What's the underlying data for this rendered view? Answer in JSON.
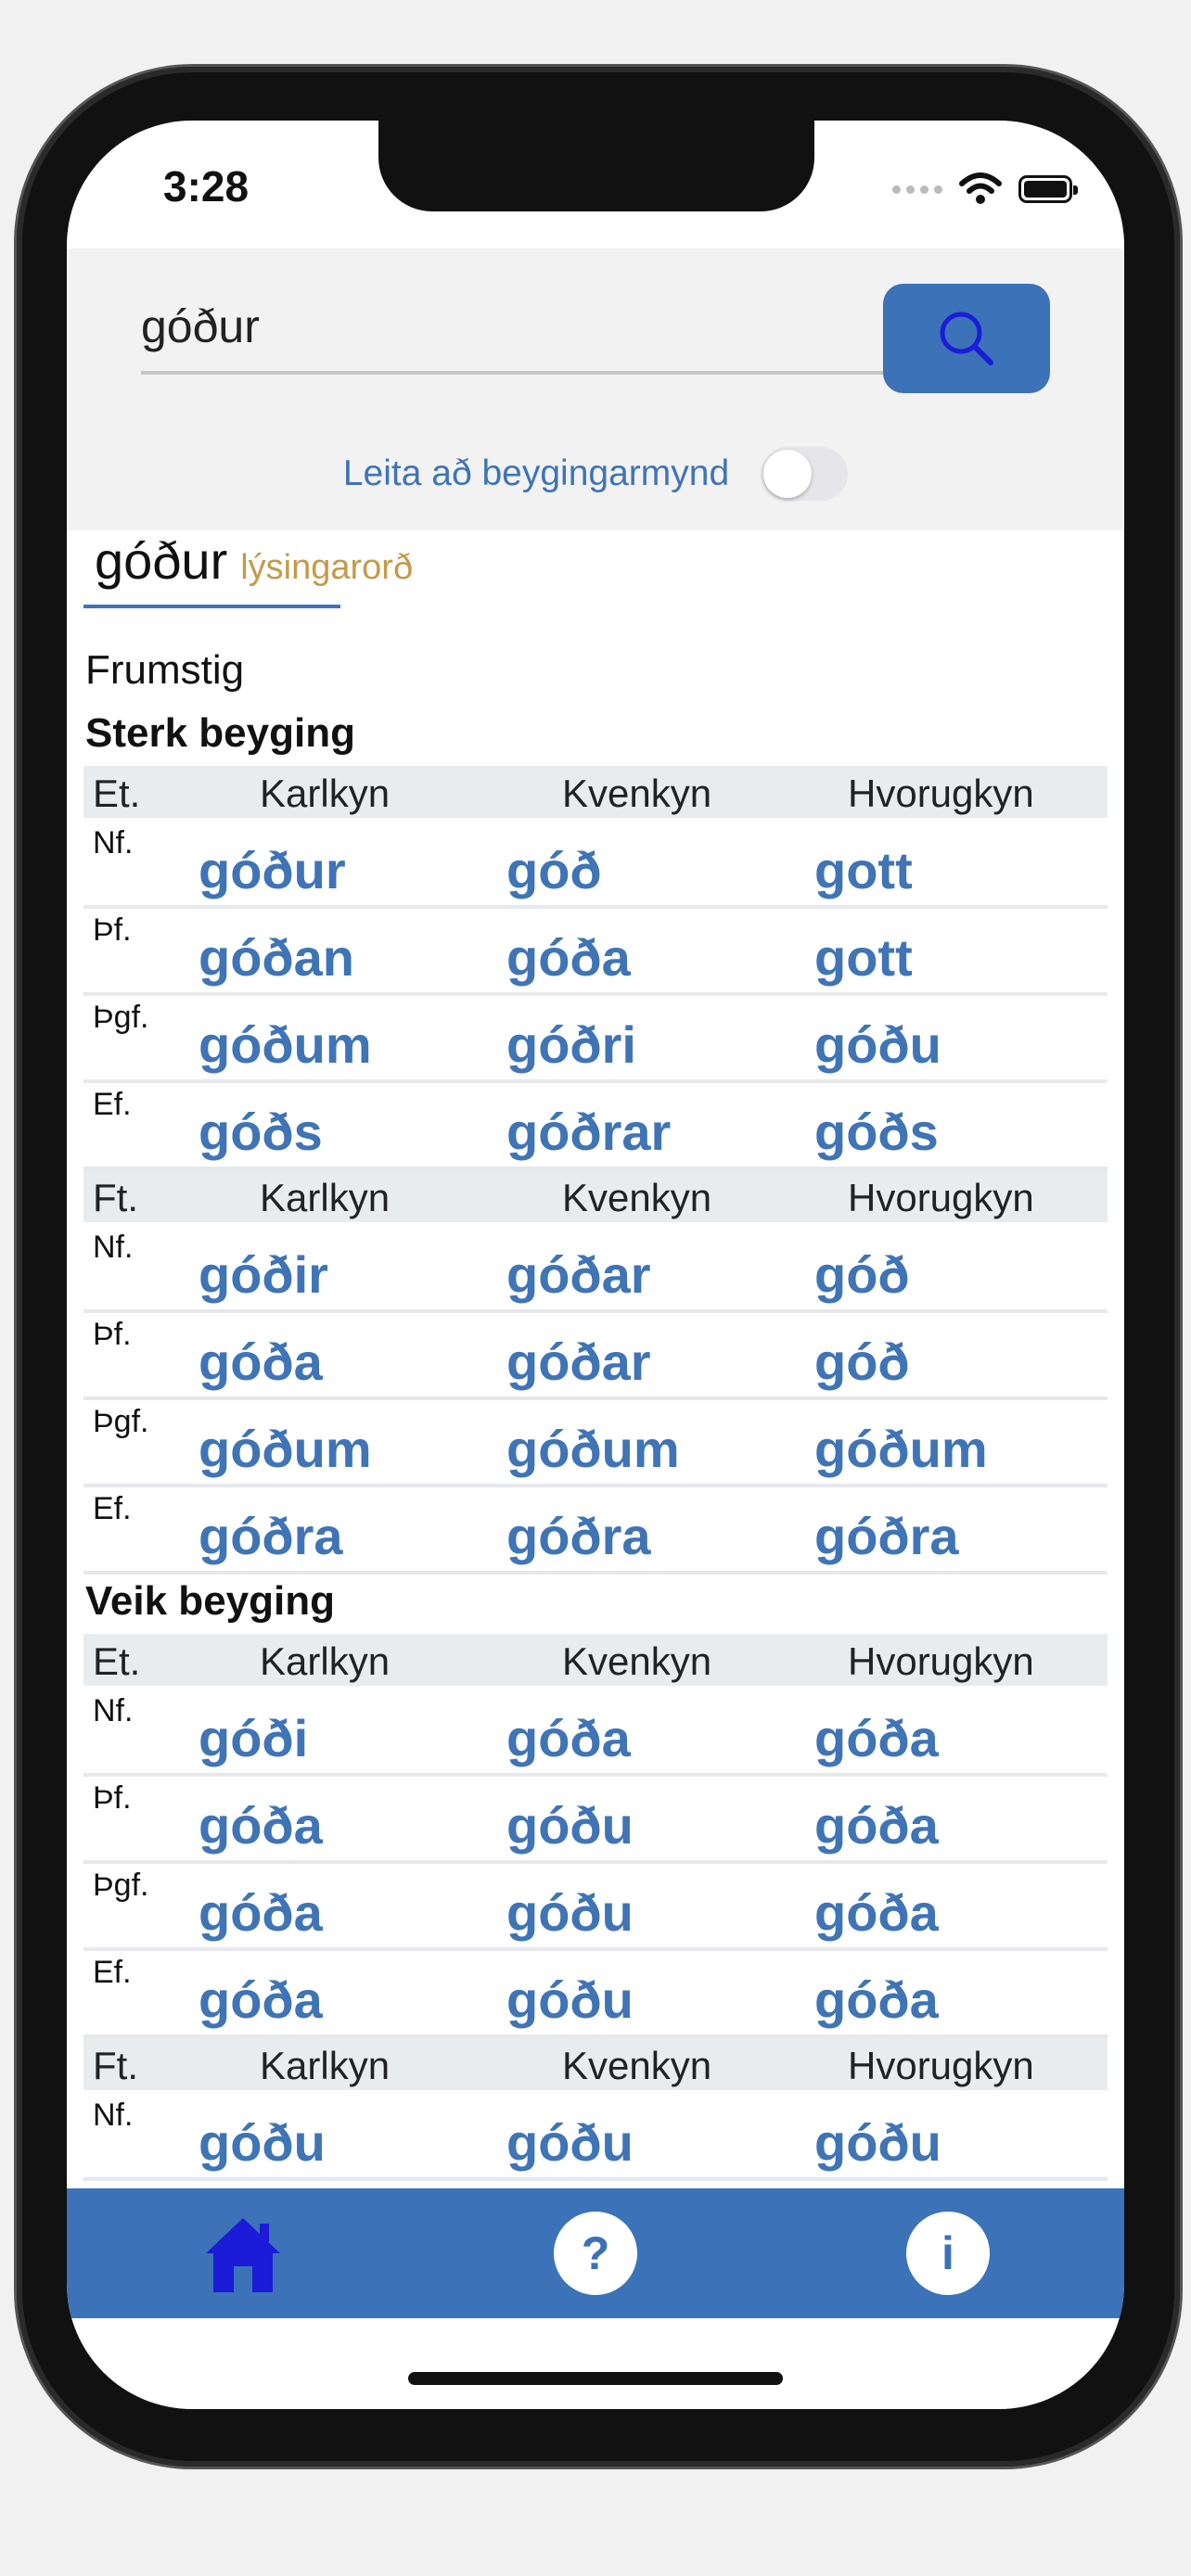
{
  "status": {
    "time": "3:28"
  },
  "search": {
    "value": "góður",
    "toggle_label": "Leita að beygingarmynd",
    "toggle_on": false
  },
  "word": {
    "title": "góður",
    "word_class": "lýsingarorð"
  },
  "degree": "Frumstig",
  "sections": [
    {
      "name": "Sterk beyging",
      "blocks": [
        {
          "number": "Et.",
          "genders": [
            "Karlkyn",
            "Kvenkyn",
            "Hvorugkyn"
          ],
          "rows": [
            {
              "case": "Nf.",
              "forms": [
                "góður",
                "góð",
                "gott"
              ]
            },
            {
              "case": "Þf.",
              "forms": [
                "góðan",
                "góða",
                "gott"
              ]
            },
            {
              "case": "Þgf.",
              "forms": [
                "góðum",
                "góðri",
                "góðu"
              ]
            },
            {
              "case": "Ef.",
              "forms": [
                "góðs",
                "góðrar",
                "góðs"
              ]
            }
          ]
        },
        {
          "number": "Ft.",
          "genders": [
            "Karlkyn",
            "Kvenkyn",
            "Hvorugkyn"
          ],
          "rows": [
            {
              "case": "Nf.",
              "forms": [
                "góðir",
                "góðar",
                "góð"
              ]
            },
            {
              "case": "Þf.",
              "forms": [
                "góða",
                "góðar",
                "góð"
              ]
            },
            {
              "case": "Þgf.",
              "forms": [
                "góðum",
                "góðum",
                "góðum"
              ]
            },
            {
              "case": "Ef.",
              "forms": [
                "góðra",
                "góðra",
                "góðra"
              ]
            }
          ]
        }
      ]
    },
    {
      "name": "Veik beyging",
      "blocks": [
        {
          "number": "Et.",
          "genders": [
            "Karlkyn",
            "Kvenkyn",
            "Hvorugkyn"
          ],
          "rows": [
            {
              "case": "Nf.",
              "forms": [
                "góði",
                "góða",
                "góða"
              ]
            },
            {
              "case": "Þf.",
              "forms": [
                "góða",
                "góðu",
                "góða"
              ]
            },
            {
              "case": "Þgf.",
              "forms": [
                "góða",
                "góðu",
                "góða"
              ]
            },
            {
              "case": "Ef.",
              "forms": [
                "góða",
                "góðu",
                "góða"
              ]
            }
          ]
        },
        {
          "number": "Ft.",
          "genders": [
            "Karlkyn",
            "Kvenkyn",
            "Hvorugkyn"
          ],
          "rows": [
            {
              "case": "Nf.",
              "forms": [
                "góðu",
                "góðu",
                "góðu"
              ]
            }
          ]
        }
      ]
    }
  ],
  "tabbar": {
    "items": [
      {
        "icon": "home-icon"
      },
      {
        "icon": "help-icon",
        "glyph": "?"
      },
      {
        "icon": "info-icon",
        "glyph": "i"
      }
    ]
  },
  "colors": {
    "accent": "#3b72b8",
    "word_class": "#c49a4a",
    "form": "#3f74b6"
  }
}
